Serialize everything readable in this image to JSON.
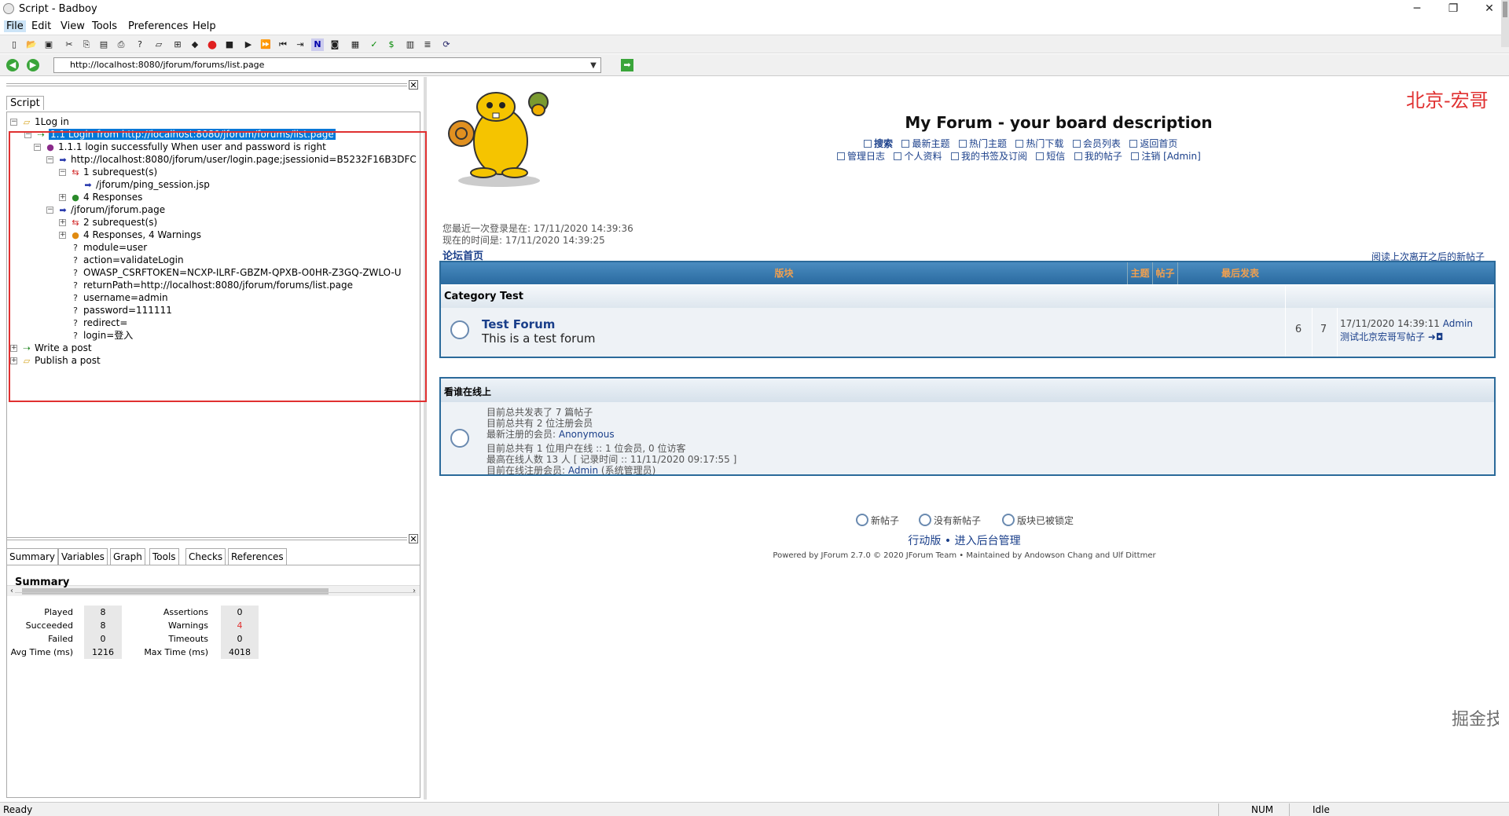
{
  "window": {
    "title": "Script - Badboy",
    "controls": {
      "minimize": "─",
      "restore": "❐",
      "close": "✕"
    }
  },
  "menu": [
    "File",
    "Edit",
    "View",
    "Tools",
    "Preferences",
    "Help"
  ],
  "toolbar": {
    "icons": [
      "new-icon",
      "open-icon",
      "save-icon",
      "cut-icon",
      "copy-icon",
      "paste-icon",
      "print-icon",
      "help-icon",
      "add-folder-icon",
      "add-step-icon",
      "add-request-icon",
      "record-icon",
      "stop-icon",
      "play-icon",
      "play-all-icon",
      "rewind-icon",
      "step-icon",
      "navigation-icon",
      "screenshot-icon",
      "report-icon",
      "check-icon",
      "variable-icon",
      "table-icon",
      "form-icon",
      "refresh-icon"
    ]
  },
  "address": {
    "url": "http://localhost:8080/jforum/forums/list.page",
    "back_glyph": "◀",
    "forward_glyph": "▶",
    "go_glyph": "➡"
  },
  "left": {
    "script_tab": "Script",
    "close": "✕",
    "tree": [
      {
        "label": "1Log in",
        "icon": "folder-icon"
      },
      {
        "label": "1.1 Login from http://localhost:8080/jforum/forums/list.page",
        "icon": "step-icon",
        "selected": true
      },
      {
        "label": "1.1.1 login successfully When user and password is right",
        "icon": "assertion-icon"
      },
      {
        "label": "http://localhost:8080/jforum/user/login.page;jsessionid=B5232F16B3DFC",
        "icon": "request-icon"
      },
      {
        "label": "1 subrequest(s)",
        "icon": "subrequest-icon"
      },
      {
        "label": "/jforum/ping_session.jsp",
        "icon": "request-icon"
      },
      {
        "label": "4 Responses",
        "icon": "response-icon"
      },
      {
        "label": "/jforum/jforum.page",
        "icon": "request-icon"
      },
      {
        "label": "2 subrequest(s)",
        "icon": "subrequest-icon"
      },
      {
        "label": "4 Responses, 4 Warnings",
        "icon": "warning-icon"
      },
      {
        "label": "module=user",
        "icon": "param-icon"
      },
      {
        "label": "action=validateLogin",
        "icon": "param-icon"
      },
      {
        "label": "OWASP_CSRFTOKEN=NCXP-ILRF-GBZM-QPXB-O0HR-Z3GQ-ZWLO-U",
        "icon": "param-icon"
      },
      {
        "label": "returnPath=http://localhost:8080/jforum/forums/list.page",
        "icon": "param-icon"
      },
      {
        "label": "username=admin",
        "icon": "param-icon"
      },
      {
        "label": "password=111111",
        "icon": "param-icon"
      },
      {
        "label": "redirect=",
        "icon": "param-icon"
      },
      {
        "label": "login=登入",
        "icon": "param-icon"
      },
      {
        "label": "Write a post",
        "icon": "step-icon"
      },
      {
        "label": "Publish a post",
        "icon": "folder-icon"
      }
    ],
    "bottom_tabs": [
      "Summary",
      "Variables",
      "Graph",
      "Tools",
      "Checks",
      "References"
    ],
    "summary": {
      "title": "Summary",
      "left": [
        {
          "label": "Played",
          "value": "8"
        },
        {
          "label": "Succeeded",
          "value": "8"
        },
        {
          "label": "Failed",
          "value": "0"
        },
        {
          "label": "Avg Time (ms)",
          "value": "1216"
        }
      ],
      "right": [
        {
          "label": "Assertions",
          "value": "0"
        },
        {
          "label": "Warnings",
          "value": "4"
        },
        {
          "label": "Timeouts",
          "value": "0"
        },
        {
          "label": "Max Time (ms)",
          "value": "4018"
        }
      ]
    }
  },
  "status": {
    "left": "Ready",
    "num": "NUM",
    "state": "Idle"
  },
  "forum": {
    "corner_label": "北京-宏哥",
    "title": "My Forum - your board description",
    "links_row1": [
      "搜索",
      "最新主题",
      "热门主题",
      "热门下载",
      "会员列表",
      "返回首页"
    ],
    "links_row2": [
      "管理日志",
      "个人资料",
      "我的书签及订阅",
      "短信",
      "我的帖子",
      "注销 [Admin]"
    ],
    "last_visit": "您最近一次登录是在: 17/11/2020 14:39:36",
    "now_time": "现在的时间是: 17/11/2020 14:39:25",
    "breadcrumb": "论坛首页",
    "new_since_link": "阅读上次离开之后的新帖子",
    "table_headers": [
      "版块",
      "主题",
      "帖子",
      "最后发表"
    ],
    "category": "Category Test",
    "forum_row": {
      "name": "Test Forum",
      "desc": "This is a test forum",
      "topics": "6",
      "posts": "7",
      "last_time": "17/11/2020 14:39:11",
      "last_user": "Admin",
      "last_title": "测试北京宏哥写帖子 ➜◘"
    },
    "online": {
      "title": "看谁在线上",
      "lines": [
        {
          "text": "目前总共发表了 7 篇帖子"
        },
        {
          "text": "目前总共有 2 位注册会员"
        },
        {
          "prefix": "最新注册的会员: ",
          "link": "Anonymous"
        },
        {
          "text": "目前总共有 1 位用户在线 :: 1 位会员, 0 位访客"
        },
        {
          "text": "最高在线人数 13 人 [ 记录时间 :: 11/11/2020 09:17:55 ]"
        },
        {
          "prefix": "目前在线注册会员: ",
          "link": "Admin",
          "suffix": " (系统管理员)"
        }
      ]
    },
    "legend": [
      "新帖子",
      "没有新帖子",
      "版块已被锁定"
    ],
    "footer_links": "行动版 • 进入后台管理",
    "powered": "Powered by JForum 2.7.0 © 2020 JForum Team • Maintained by Andowson Chang and Ulf Dittmer",
    "watermark": "掘金技术社区 @ 北京_宏哥"
  }
}
